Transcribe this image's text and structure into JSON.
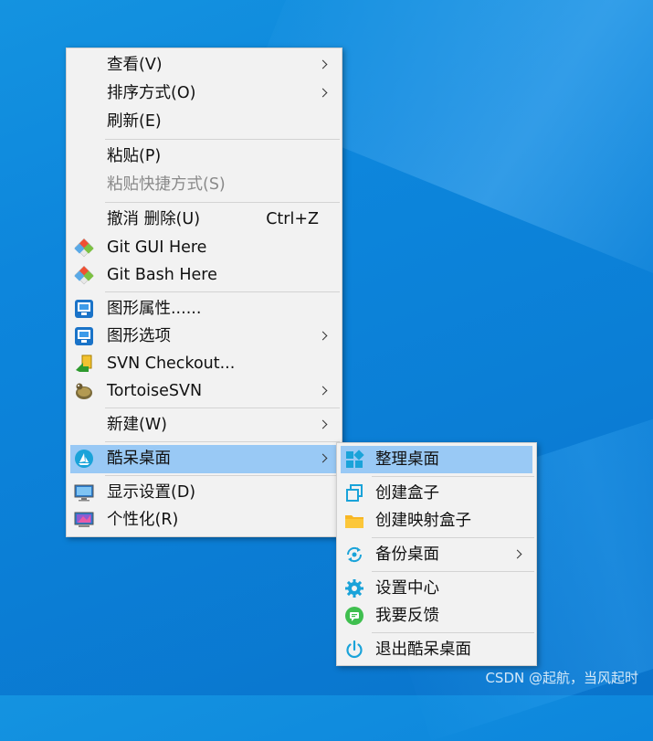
{
  "main_menu": {
    "items": [
      {
        "label": "查看(V)",
        "icon": "",
        "submenu": true
      },
      {
        "label": "排序方式(O)",
        "icon": "",
        "submenu": true
      },
      {
        "label": "刷新(E)",
        "icon": "",
        "submenu": false
      },
      {
        "label": "粘贴(P)",
        "icon": "",
        "submenu": false
      },
      {
        "label": "粘贴快捷方式(S)",
        "icon": "",
        "submenu": false,
        "disabled": true
      },
      {
        "label": "撤消 删除(U)",
        "shortcut": "Ctrl+Z",
        "icon": "",
        "submenu": false
      },
      {
        "label": "Git GUI Here",
        "icon": "git-icon",
        "submenu": false
      },
      {
        "label": "Git Bash Here",
        "icon": "git-icon",
        "submenu": false
      },
      {
        "label": "图形属性......",
        "icon": "intel-graphics-icon",
        "submenu": false
      },
      {
        "label": "图形选项",
        "icon": "intel-graphics-icon",
        "submenu": true
      },
      {
        "label": "SVN Checkout...",
        "icon": "svn-checkout-icon",
        "submenu": false
      },
      {
        "label": "TortoiseSVN",
        "icon": "tortoise-icon",
        "submenu": true
      },
      {
        "label": "新建(W)",
        "icon": "",
        "submenu": true
      },
      {
        "label": "酷呆桌面",
        "icon": "kudai-logo-icon",
        "submenu": true,
        "highlighted": true
      },
      {
        "label": "显示设置(D)",
        "icon": "display-icon",
        "submenu": false
      },
      {
        "label": "个性化(R)",
        "icon": "personalize-icon",
        "submenu": false
      }
    ]
  },
  "sub_menu": {
    "items": [
      {
        "label": "整理桌面",
        "icon": "grid-tiles-icon",
        "highlighted": true
      },
      {
        "label": "创建盒子",
        "icon": "copy-boxes-icon"
      },
      {
        "label": "创建映射盒子",
        "icon": "folder-icon"
      },
      {
        "label": "备份桌面",
        "icon": "backup-sync-icon",
        "submenu": true
      },
      {
        "label": "设置中心",
        "icon": "gear-icon"
      },
      {
        "label": "我要反馈",
        "icon": "feedback-chat-icon"
      },
      {
        "label": "退出酷呆桌面",
        "icon": "power-icon"
      }
    ]
  },
  "watermark": "CSDN @起航，当风起时",
  "colors": {
    "desktop_blue": "#0b7fd6",
    "menu_bg": "#f2f2f2",
    "highlight": "#99c9f5",
    "accent_cyan": "#1aa3d9"
  }
}
